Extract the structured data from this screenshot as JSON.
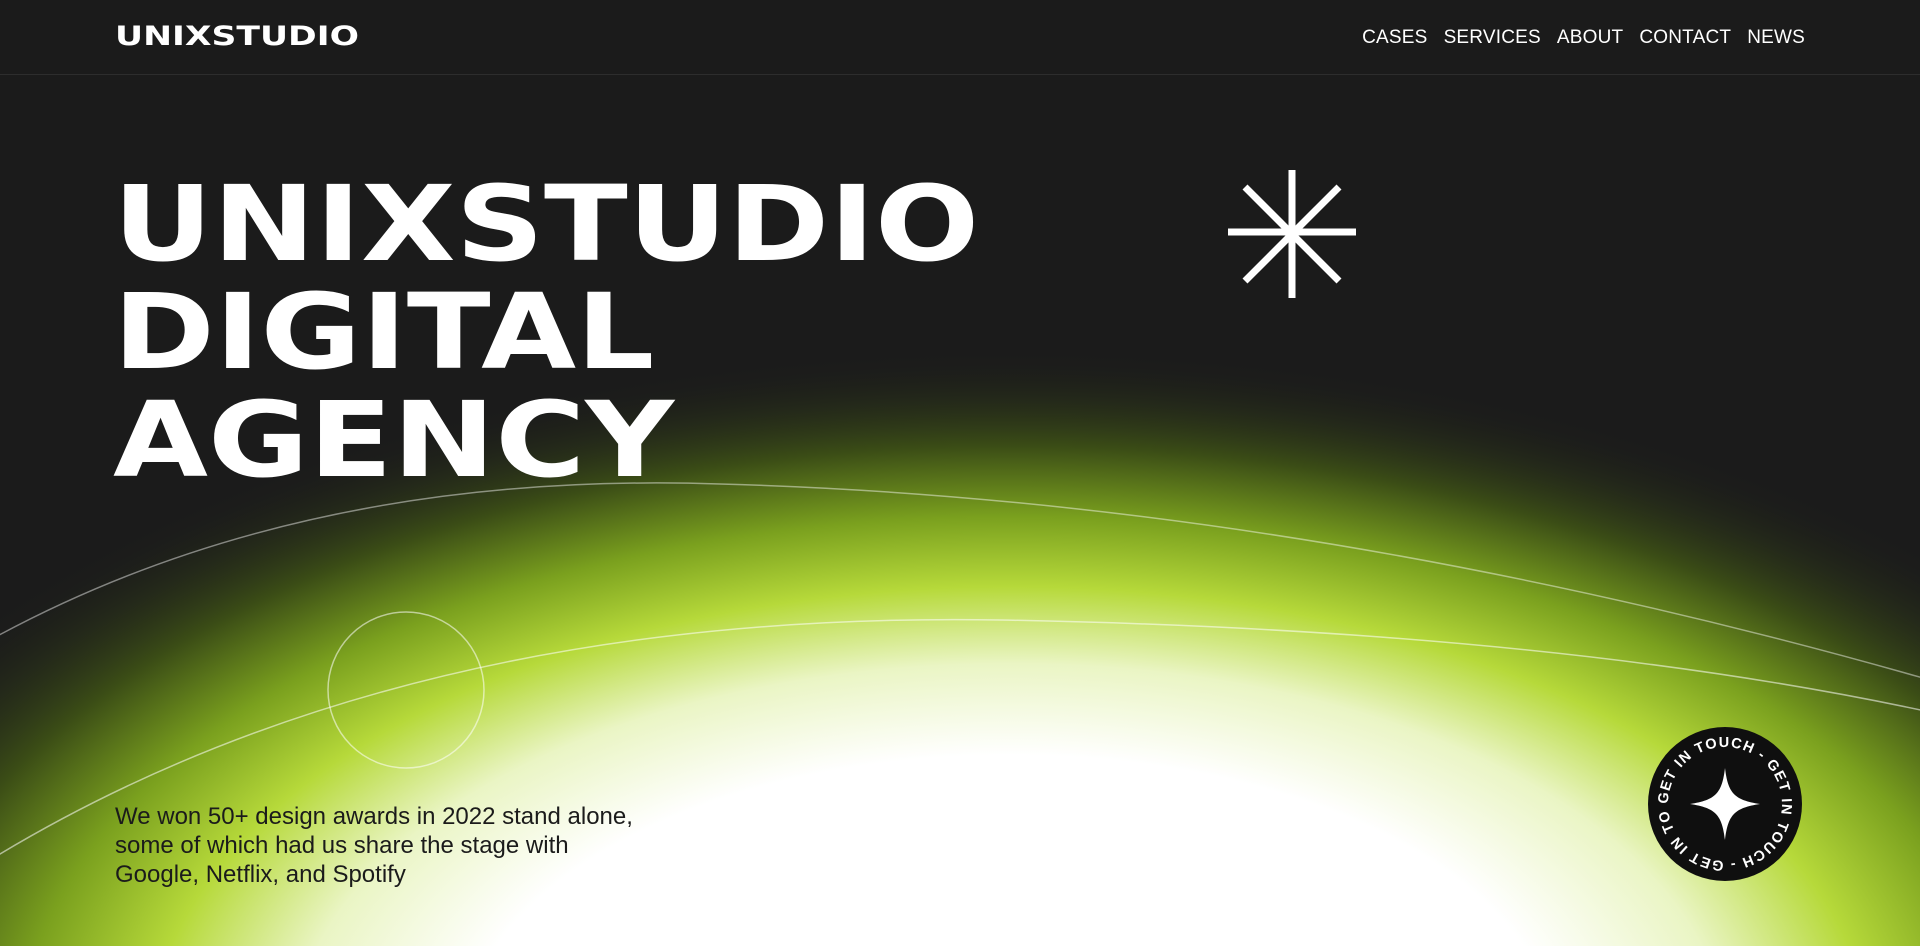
{
  "header": {
    "logo": "UNIXSTUDIO",
    "nav": [
      "CASES",
      "SERVICES",
      "ABOUT",
      "CONTACT",
      "NEWS"
    ]
  },
  "hero": {
    "title_lines": [
      "UNIXSTUDIO",
      "DIGITAL",
      "AGENCY"
    ],
    "tagline_lines": [
      "We won 50+ design awards in 2022 stand alone,",
      "some of which had us share the stage with",
      "Google, Netflix, and Spotify"
    ]
  },
  "cta": {
    "ring_text": "GET IN TOUCH - GET IN TOUCH - GET IN TOUCH - ",
    "icon": "four-point-star-icon"
  },
  "icons": {
    "decor": "asterisk-icon"
  },
  "colors": {
    "background": "#1b1b1b",
    "accent": "#a8d12a",
    "text_light": "#ffffff",
    "text_dark": "#1b1b1b"
  }
}
